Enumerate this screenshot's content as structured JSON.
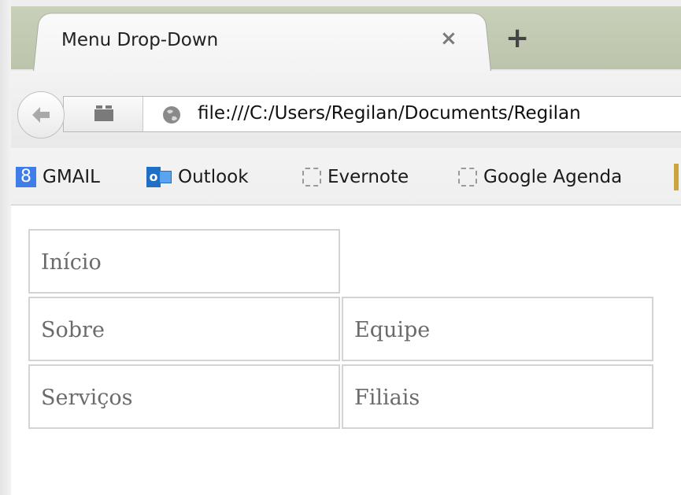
{
  "browser": {
    "tab": {
      "title": "Menu Drop-Down",
      "close_glyph": "×"
    },
    "new_tab_glyph": "+",
    "address_bar": {
      "url": "file:///C:/Users/Regilan/Documents/Regilan"
    },
    "bookmarks": [
      {
        "label": "GMAIL",
        "icon": "google-plus-icon",
        "icon_glyph": "8"
      },
      {
        "label": "Outlook",
        "icon": "outlook-icon",
        "icon_glyph": "o"
      },
      {
        "label": "Evernote",
        "icon": "placeholder-page-icon"
      },
      {
        "label": "Google Agenda",
        "icon": "placeholder-page-icon"
      }
    ]
  },
  "page": {
    "menu": {
      "rows": [
        {
          "main": "Início",
          "sub": ""
        },
        {
          "main": "Sobre",
          "sub": "Equipe"
        },
        {
          "main": "Serviços",
          "sub": "Filiais"
        }
      ]
    }
  },
  "colors": {
    "tabstrip": "#c9d0b9",
    "cell_border": "#d3d3d3",
    "cell_text": "#6b6b6b",
    "gmail_icon": "#3f7ee8",
    "outlook_icon": "#1f6fc5"
  }
}
